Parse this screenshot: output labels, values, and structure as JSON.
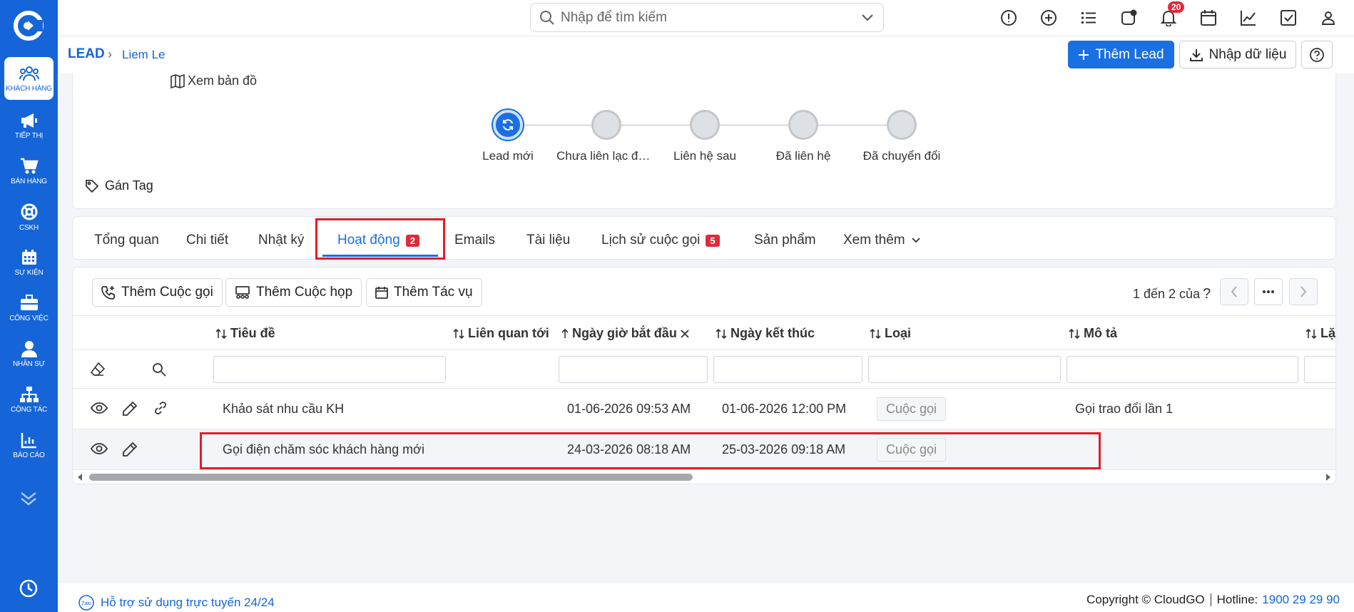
{
  "sidebar": {
    "items": [
      {
        "label": "KHÁCH HÀNG"
      },
      {
        "label": "TIẾP THỊ"
      },
      {
        "label": "BÁN HÀNG"
      },
      {
        "label": "CSKH"
      },
      {
        "label": "SỰ KIỆN"
      },
      {
        "label": "CÔNG VIỆC"
      },
      {
        "label": "NHÂN SỰ"
      },
      {
        "label": "CỘNG TÁC"
      },
      {
        "label": "BÁO CÁO"
      }
    ]
  },
  "topbar": {
    "search_placeholder": "Nhập để tìm kiếm",
    "notification_count": "20"
  },
  "breadcrumb": {
    "root": "LEAD",
    "current": "Liem Le"
  },
  "actions": {
    "add_lead": "Thêm Lead",
    "import": "Nhập dữ liệu"
  },
  "record": {
    "map_link": "Xem bản đồ",
    "tag_label": "Gán Tag"
  },
  "pipeline": {
    "stages": [
      {
        "label": "Lead mới",
        "active": true
      },
      {
        "label": "Chưa liên lạc được",
        "active": false
      },
      {
        "label": "Liên hệ sau",
        "active": false
      },
      {
        "label": "Đã liên hệ",
        "active": false
      },
      {
        "label": "Đã chuyển đổi",
        "active": false
      }
    ]
  },
  "tabs": [
    {
      "label": "Tổng quan"
    },
    {
      "label": "Chi tiết"
    },
    {
      "label": "Nhật ký"
    },
    {
      "label": "Hoạt động",
      "badge": "2",
      "active": true
    },
    {
      "label": "Emails"
    },
    {
      "label": "Tài liệu"
    },
    {
      "label": "Lịch sử cuộc gọi",
      "badge": "5"
    },
    {
      "label": "Sản phẩm"
    },
    {
      "label": "Xem thêm"
    }
  ],
  "activity": {
    "add_call": "Thêm Cuộc gọi",
    "add_meeting": "Thêm Cuộc họp",
    "add_task": "Thêm Tác vụ",
    "pager_text": "1 đến 2 của",
    "pager_unknown": "?",
    "columns": [
      {
        "label": "Tiêu đề"
      },
      {
        "label": "Liên quan tới"
      },
      {
        "label": "Ngày giờ bắt đầu"
      },
      {
        "label": "Ngày kết thúc"
      },
      {
        "label": "Loại"
      },
      {
        "label": "Mô tả"
      },
      {
        "label": "Lặ"
      }
    ],
    "rows": [
      {
        "title": "Khảo sát nhu cầu KH",
        "related": "",
        "start": "01-06-2026 09:53 AM",
        "end": "01-06-2026 12:00 PM",
        "type": "Cuộc gọi",
        "desc": "Gọi trao đổi lần 1"
      },
      {
        "title": "Gọi điện chăm sóc khách hàng mới",
        "related": "",
        "start": "24-03-2026 08:18 AM",
        "end": "25-03-2026 09:18 AM",
        "type": "Cuộc gọi",
        "desc": ""
      }
    ]
  },
  "footer": {
    "support": "Hỗ trợ sử dụng trực tuyến 24/24",
    "zalo": "Zalo",
    "copyright": "Copyright © CloudGO",
    "hotline_label": "Hotline:",
    "hotline": "1900 29 29 90"
  },
  "colors": {
    "brand": "#1565d8",
    "primary_button": "#1a6fe2",
    "badge": "#e02a3b",
    "highlight": "#e11d2a"
  }
}
